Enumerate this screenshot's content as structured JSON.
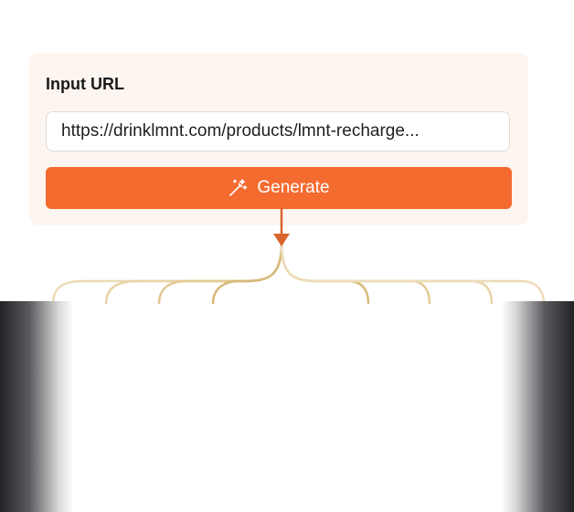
{
  "card": {
    "title": "Input URL",
    "url_value": "https://drinklmnt.com/products/lmnt-recharge...",
    "generate_label": "Generate"
  },
  "colors": {
    "card_bg": "#fdf5f0",
    "button_bg": "#f46b30",
    "arrow": "#d8652b",
    "branch_line": "#d9b97a",
    "branch_faded": "#efe2c6"
  },
  "icons": {
    "generate": "magic-wand-icon",
    "connector": "arrow-down-icon"
  }
}
